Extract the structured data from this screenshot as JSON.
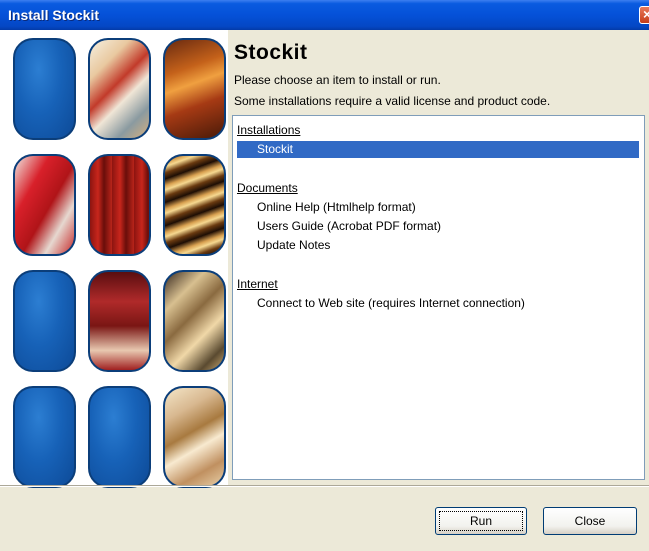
{
  "window": {
    "title": "Install Stockit",
    "close_glyph": "×"
  },
  "tiles": [
    {
      "icon": "blue-panel"
    },
    {
      "icon": "photo-panel"
    },
    {
      "icon": "photo-panel"
    },
    {
      "icon": "photo-panel"
    },
    {
      "icon": "photo-panel"
    },
    {
      "icon": "photo-panel"
    },
    {
      "icon": "blue-panel"
    },
    {
      "icon": "photo-panel"
    },
    {
      "icon": "photo-panel"
    },
    {
      "icon": "blue-panel"
    },
    {
      "icon": "blue-panel"
    },
    {
      "icon": "photo-panel"
    }
  ],
  "header": {
    "title": "Stockit",
    "line1": "Please choose an item to install or run.",
    "line2": "Some installations require a valid license and product code."
  },
  "list": {
    "groups": [
      {
        "label": "Installations",
        "items": [
          "Stockit"
        ]
      },
      {
        "label": "Documents",
        "items": [
          "Online Help (Htmlhelp format)",
          "Users Guide (Acrobat PDF format)",
          "Update Notes"
        ]
      },
      {
        "label": "Internet",
        "items": [
          "Connect to Web site (requires Internet connection)"
        ]
      }
    ],
    "selected": "Stockit",
    "selection_color": "#316ac5"
  },
  "buttons": {
    "run": "Run",
    "close": "Close"
  }
}
